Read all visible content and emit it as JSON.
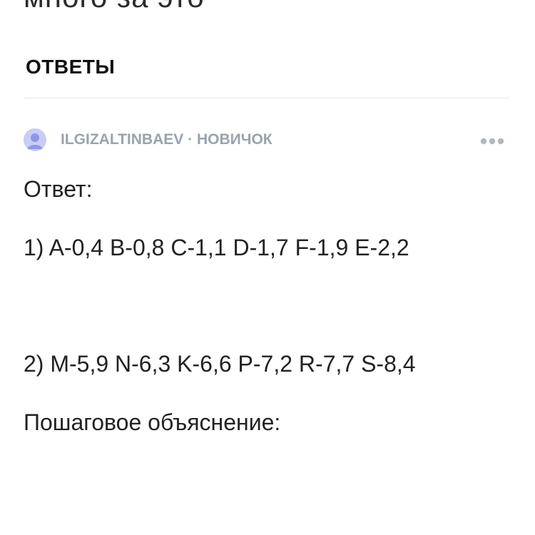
{
  "page_header": {
    "title_partial": "много за это"
  },
  "answers_section": {
    "heading": "ОТВЕТЫ"
  },
  "answer": {
    "author": {
      "username": "ILGIZALTINBAEV",
      "separator": " · ",
      "rank": "НОВИЧОК"
    },
    "avatar_color": "#c7cdf6",
    "more_icon": "more-horizontal-icon",
    "lines": {
      "label": "Ответ:",
      "line1": "1) A-0,4 B-0,8 C-1,1 D-1,7 F-1,9 E-2,2",
      "line2": "2) M-5,9 N-6,3 K-6,6 P-7,2 R-7,7 S-8,4",
      "explanation_label": "Пошаговое объяснение:"
    }
  }
}
